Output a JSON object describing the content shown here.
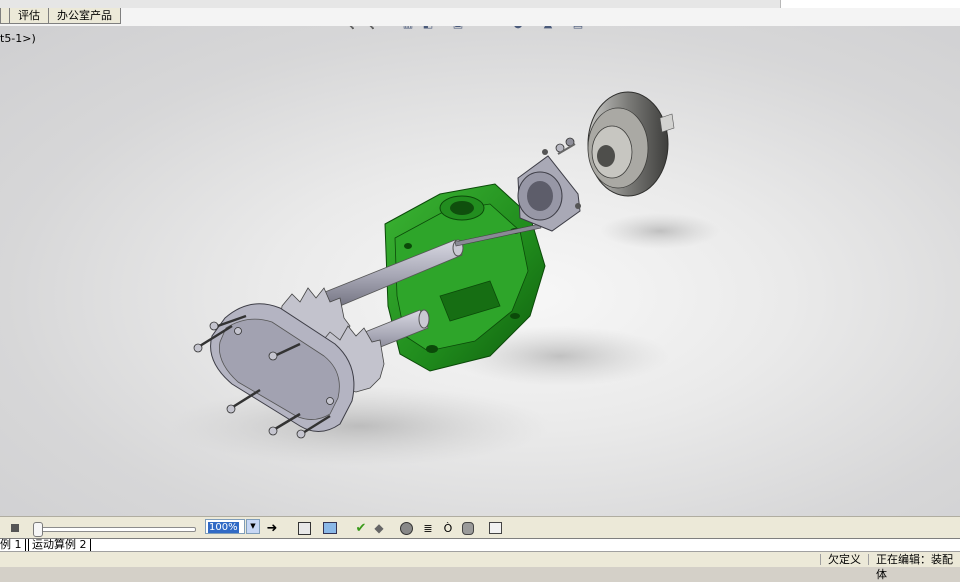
{
  "tabs": [
    {
      "label": ""
    },
    {
      "label": "评估"
    },
    {
      "label": "办公室产品"
    }
  ],
  "viewport": {
    "tree_label": "t5-1>)"
  },
  "hud_icons": [
    "zoom-to-fit-icon",
    "zoom-to-area-icon",
    "previous-view-icon",
    "section-view-icon",
    "view-orientation-icon",
    "display-style-icon",
    "hide-show-items-icon",
    "edit-appearance-icon",
    "apply-scene-icon",
    "view-settings-icon"
  ],
  "colors": {
    "body_green": "#1f8a1c",
    "steel": "#a9a9b6",
    "pulley": "#7a7a78"
  },
  "motion_toolbar": {
    "zoom_value": "100%",
    "icons": [
      "stop-icon",
      "play-arrow-icon",
      "save-animation-icon",
      "animation-wizard-icon",
      "autokey-icon",
      "add-key-icon",
      "motor-icon",
      "spring-icon",
      "contact-icon",
      "gravity-icon",
      "results-icon"
    ]
  },
  "model_tabs": [
    {
      "label": "例 1"
    },
    {
      "label": "运动算例 2"
    }
  ],
  "status": {
    "underdefined": "欠定义",
    "editing": "正在编辑：装配体"
  }
}
